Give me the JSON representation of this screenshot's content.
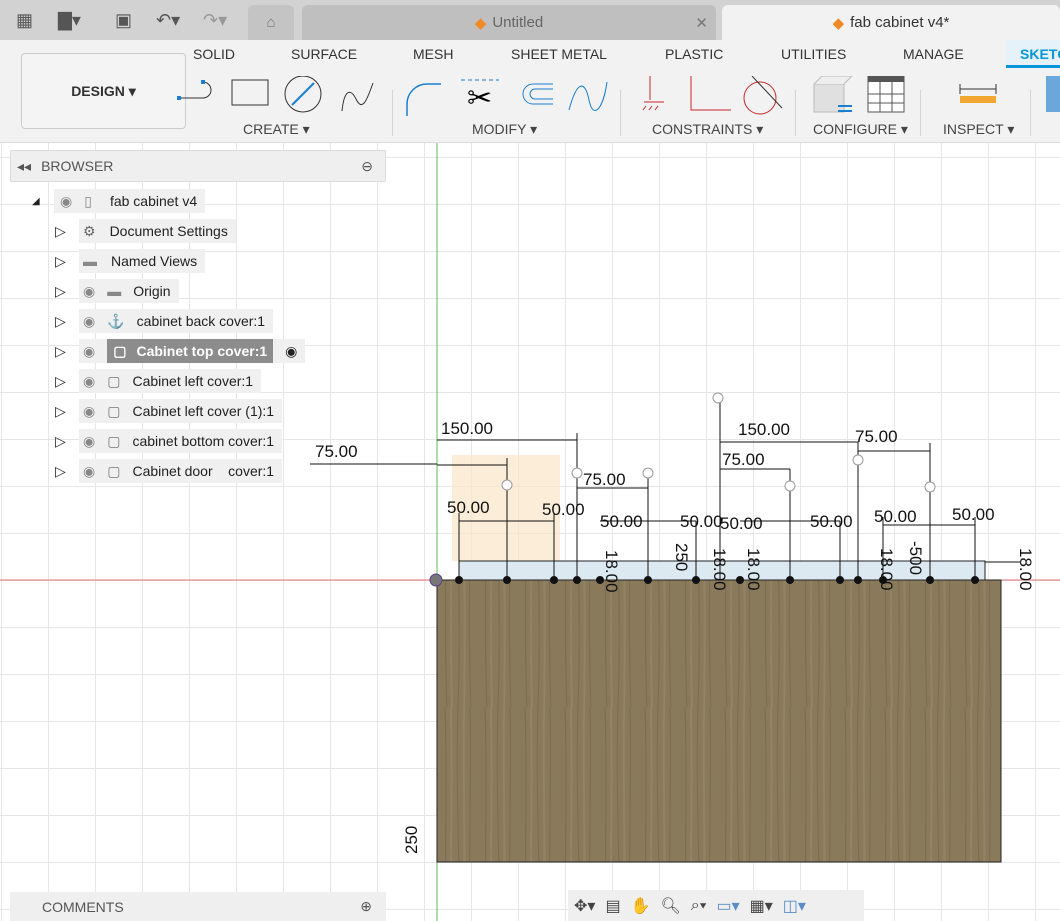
{
  "quick_access": {
    "icons": [
      "apps-grid-icon",
      "file-icon",
      "save-icon",
      "undo-icon",
      "redo-icon",
      "home-icon"
    ]
  },
  "tabs": [
    {
      "label": "Untitled",
      "active": false
    },
    {
      "label": "fab cabinet v4*",
      "active": true
    }
  ],
  "ribbon": {
    "workspace": "DESIGN",
    "tabs": [
      "SOLID",
      "SURFACE",
      "MESH",
      "SHEET METAL",
      "PLASTIC",
      "UTILITIES",
      "MANAGE",
      "SKETCH"
    ],
    "active_tab": "SKETCH",
    "groups": [
      "CREATE",
      "MODIFY",
      "CONSTRAINTS",
      "CONFIGURE",
      "INSPECT"
    ],
    "accent": "#0696d7"
  },
  "browser": {
    "title": "BROWSER",
    "root": "fab cabinet v4",
    "items": [
      {
        "label": "Document Settings",
        "icon": "gear-icon"
      },
      {
        "label": "Named Views",
        "icon": "folder-icon"
      },
      {
        "label": "Origin",
        "icon": "folder-icon"
      },
      {
        "label": "cabinet back cover:1",
        "icon": "component-anchor-icon"
      },
      {
        "label": "Cabinet top cover:1",
        "icon": "component-icon",
        "selected": true
      },
      {
        "label": "Cabinet left cover:1",
        "icon": "component-icon"
      },
      {
        "label": "Cabinet left cover (1):1",
        "icon": "component-icon"
      },
      {
        "label": "cabinet bottom cover:1",
        "icon": "component-icon"
      },
      {
        "label": "Cabinet door    cover:1",
        "icon": "component-icon"
      }
    ]
  },
  "comments": {
    "title": "COMMENTS"
  },
  "sketch": {
    "dimensions": [
      "150.00",
      "75.00",
      "75.00",
      "50.00",
      "50.00",
      "50.00",
      "50.00",
      "50.00",
      "50.00",
      "150.00",
      "75.00",
      "75.00",
      "50.00",
      "50.00",
      "50.00",
      "18.00",
      "250",
      "18.00",
      "18.00",
      "18.00",
      "-500",
      "18.00",
      "250"
    ],
    "wood_color": "#8a7a5c"
  },
  "nav_toolbar": {
    "icons": [
      "orbit-icon",
      "look-at-icon",
      "pan-icon",
      "zoom-icon",
      "zoom-window-icon",
      "display-settings-icon",
      "grid-icon",
      "viewports-icon"
    ]
  }
}
